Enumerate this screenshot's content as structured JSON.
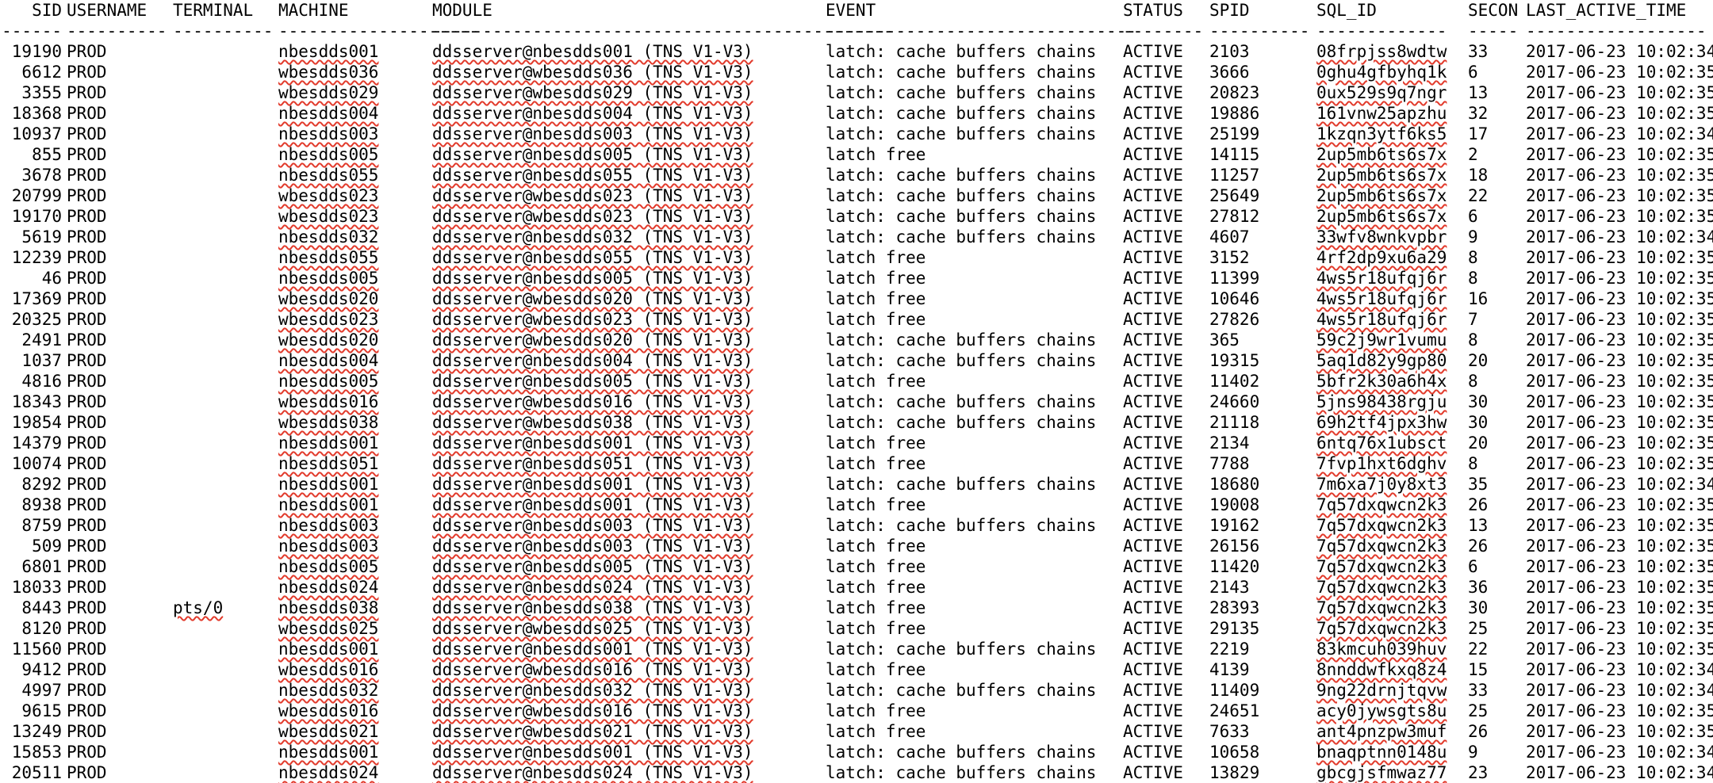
{
  "headers": {
    "sid": "SID",
    "username": "USERNAME",
    "terminal": "TERMINAL",
    "machine": "MACHINE",
    "module": "MODULE",
    "event": "EVENT",
    "status": "STATUS",
    "spid": "SPID",
    "sql_id": "SQL_ID",
    "secon": "SECON",
    "last_active_time": "LAST_ACTIVE_TIME"
  },
  "separators": {
    "sid": "------",
    "username": "----------",
    "terminal": "----------",
    "machine": "--------------------",
    "module": "----------------------------------------------",
    "event": "-------------------------------",
    "status": "--------",
    "spid": "----------",
    "sql_id": "-------------",
    "secon": "-----",
    "last_active_time": "------------------"
  },
  "rows": [
    {
      "sid": "19190",
      "username": "PROD",
      "terminal": "",
      "machine": "nbesdds001",
      "module": "ddsserver@nbesdds001 (TNS V1-V3)",
      "event": "latch: cache buffers chains",
      "status": "ACTIVE",
      "spid": "2103",
      "sql_id": "08frpjss8wdtw",
      "secon": "33",
      "last_active_time": "2017-06-23 10:02:34"
    },
    {
      "sid": "6612",
      "username": "PROD",
      "terminal": "",
      "machine": "wbesdds036",
      "module": "ddsserver@wbesdds036 (TNS V1-V3)",
      "event": "latch: cache buffers chains",
      "status": "ACTIVE",
      "spid": "3666",
      "sql_id": "0ghu4gfbyhq1k",
      "secon": "6",
      "last_active_time": "2017-06-23 10:02:35"
    },
    {
      "sid": "3355",
      "username": "PROD",
      "terminal": "",
      "machine": "wbesdds029",
      "module": "ddsserver@wbesdds029 (TNS V1-V3)",
      "event": "latch: cache buffers chains",
      "status": "ACTIVE",
      "spid": "20823",
      "sql_id": "0ux529s9q7ngr",
      "secon": "13",
      "last_active_time": "2017-06-23 10:02:35"
    },
    {
      "sid": "18368",
      "username": "PROD",
      "terminal": "",
      "machine": "nbesdds004",
      "module": "ddsserver@nbesdds004 (TNS V1-V3)",
      "event": "latch: cache buffers chains",
      "status": "ACTIVE",
      "spid": "19886",
      "sql_id": "161vnw25apzhu",
      "secon": "32",
      "last_active_time": "2017-06-23 10:02:35"
    },
    {
      "sid": "10937",
      "username": "PROD",
      "terminal": "",
      "machine": "nbesdds003",
      "module": "ddsserver@nbesdds003 (TNS V1-V3)",
      "event": "latch: cache buffers chains",
      "status": "ACTIVE",
      "spid": "25199",
      "sql_id": "1kzqn3ytf6ks5",
      "secon": "17",
      "last_active_time": "2017-06-23 10:02:34"
    },
    {
      "sid": "855",
      "username": "PROD",
      "terminal": "",
      "machine": "nbesdds005",
      "module": "ddsserver@nbesdds005 (TNS V1-V3)",
      "event": "latch free",
      "status": "ACTIVE",
      "spid": "14115",
      "sql_id": "2up5mb6ts6s7x",
      "secon": "2",
      "last_active_time": "2017-06-23 10:02:35"
    },
    {
      "sid": "3678",
      "username": "PROD",
      "terminal": "",
      "machine": "nbesdds055",
      "module": "ddsserver@nbesdds055 (TNS V1-V3)",
      "event": "latch: cache buffers chains",
      "status": "ACTIVE",
      "spid": "11257",
      "sql_id": "2up5mb6ts6s7x",
      "secon": "18",
      "last_active_time": "2017-06-23 10:02:35"
    },
    {
      "sid": "20799",
      "username": "PROD",
      "terminal": "",
      "machine": "wbesdds023",
      "module": "ddsserver@wbesdds023 (TNS V1-V3)",
      "event": "latch: cache buffers chains",
      "status": "ACTIVE",
      "spid": "25649",
      "sql_id": "2up5mb6ts6s7x",
      "secon": "22",
      "last_active_time": "2017-06-23 10:02:35"
    },
    {
      "sid": "19170",
      "username": "PROD",
      "terminal": "",
      "machine": "wbesdds023",
      "module": "ddsserver@wbesdds023 (TNS V1-V3)",
      "event": "latch: cache buffers chains",
      "status": "ACTIVE",
      "spid": "27812",
      "sql_id": "2up5mb6ts6s7x",
      "secon": "6",
      "last_active_time": "2017-06-23 10:02:35"
    },
    {
      "sid": "5619",
      "username": "PROD",
      "terminal": "",
      "machine": "nbesdds032",
      "module": "ddsserver@nbesdds032 (TNS V1-V3)",
      "event": "latch: cache buffers chains",
      "status": "ACTIVE",
      "spid": "4607",
      "sql_id": "33wfv8wnkvpbr",
      "secon": "9",
      "last_active_time": "2017-06-23 10:02:34"
    },
    {
      "sid": "12239",
      "username": "PROD",
      "terminal": "",
      "machine": "nbesdds055",
      "module": "ddsserver@nbesdds055 (TNS V1-V3)",
      "event": "latch free",
      "status": "ACTIVE",
      "spid": "3152",
      "sql_id": "4rf2dp9xu6a29",
      "secon": "8",
      "last_active_time": "2017-06-23 10:02:35"
    },
    {
      "sid": "46",
      "username": "PROD",
      "terminal": "",
      "machine": "nbesdds005",
      "module": "ddsserver@nbesdds005 (TNS V1-V3)",
      "event": "latch free",
      "status": "ACTIVE",
      "spid": "11399",
      "sql_id": "4ws5r18ufqj6r",
      "secon": "8",
      "last_active_time": "2017-06-23 10:02:35"
    },
    {
      "sid": "17369",
      "username": "PROD",
      "terminal": "",
      "machine": "wbesdds020",
      "module": "ddsserver@wbesdds020 (TNS V1-V3)",
      "event": "latch free",
      "status": "ACTIVE",
      "spid": "10646",
      "sql_id": "4ws5r18ufqj6r",
      "secon": "16",
      "last_active_time": "2017-06-23 10:02:35"
    },
    {
      "sid": "20325",
      "username": "PROD",
      "terminal": "",
      "machine": "wbesdds023",
      "module": "ddsserver@wbesdds023 (TNS V1-V3)",
      "event": "latch free",
      "status": "ACTIVE",
      "spid": "27826",
      "sql_id": "4ws5r18ufqj6r",
      "secon": "7",
      "last_active_time": "2017-06-23 10:02:35"
    },
    {
      "sid": "2491",
      "username": "PROD",
      "terminal": "",
      "machine": "wbesdds020",
      "module": "ddsserver@wbesdds020 (TNS V1-V3)",
      "event": "latch: cache buffers chains",
      "status": "ACTIVE",
      "spid": "365",
      "sql_id": "59c2j9wr1vumu",
      "secon": "8",
      "last_active_time": "2017-06-23 10:02:35"
    },
    {
      "sid": "1037",
      "username": "PROD",
      "terminal": "",
      "machine": "nbesdds004",
      "module": "ddsserver@nbesdds004 (TNS V1-V3)",
      "event": "latch: cache buffers chains",
      "status": "ACTIVE",
      "spid": "19315",
      "sql_id": "5aq1d82y9gp80",
      "secon": "20",
      "last_active_time": "2017-06-23 10:02:35"
    },
    {
      "sid": "4816",
      "username": "PROD",
      "terminal": "",
      "machine": "nbesdds005",
      "module": "ddsserver@nbesdds005 (TNS V1-V3)",
      "event": "latch free",
      "status": "ACTIVE",
      "spid": "11402",
      "sql_id": "5bfr2k30a6h4x",
      "secon": "8",
      "last_active_time": "2017-06-23 10:02:35"
    },
    {
      "sid": "18343",
      "username": "PROD",
      "terminal": "",
      "machine": "wbesdds016",
      "module": "ddsserver@wbesdds016 (TNS V1-V3)",
      "event": "latch: cache buffers chains",
      "status": "ACTIVE",
      "spid": "24660",
      "sql_id": "5jns98438rgju",
      "secon": "30",
      "last_active_time": "2017-06-23 10:02:35"
    },
    {
      "sid": "19854",
      "username": "PROD",
      "terminal": "",
      "machine": "wbesdds038",
      "module": "ddsserver@wbesdds038 (TNS V1-V3)",
      "event": "latch: cache buffers chains",
      "status": "ACTIVE",
      "spid": "21118",
      "sql_id": "69h2tf4jpx3hw",
      "secon": "30",
      "last_active_time": "2017-06-23 10:02:35"
    },
    {
      "sid": "14379",
      "username": "PROD",
      "terminal": "",
      "machine": "nbesdds001",
      "module": "ddsserver@nbesdds001 (TNS V1-V3)",
      "event": "latch free",
      "status": "ACTIVE",
      "spid": "2134",
      "sql_id": "6ntq76x1ubsct",
      "secon": "20",
      "last_active_time": "2017-06-23 10:02:35"
    },
    {
      "sid": "10074",
      "username": "PROD",
      "terminal": "",
      "machine": "nbesdds051",
      "module": "ddsserver@nbesdds051 (TNS V1-V3)",
      "event": "latch free",
      "status": "ACTIVE",
      "spid": "7788",
      "sql_id": "7fvp1hxt6dghv",
      "secon": "8",
      "last_active_time": "2017-06-23 10:02:35"
    },
    {
      "sid": "8292",
      "username": "PROD",
      "terminal": "",
      "machine": "nbesdds001",
      "module": "ddsserver@nbesdds001 (TNS V1-V3)",
      "event": "latch: cache buffers chains",
      "status": "ACTIVE",
      "spid": "18680",
      "sql_id": "7m6xa7j0y8xt3",
      "secon": "35",
      "last_active_time": "2017-06-23 10:02:34"
    },
    {
      "sid": "8938",
      "username": "PROD",
      "terminal": "",
      "machine": "nbesdds001",
      "module": "ddsserver@nbesdds001 (TNS V1-V3)",
      "event": "latch free",
      "status": "ACTIVE",
      "spid": "19008",
      "sql_id": "7q57dxqwcn2k3",
      "secon": "26",
      "last_active_time": "2017-06-23 10:02:35"
    },
    {
      "sid": "8759",
      "username": "PROD",
      "terminal": "",
      "machine": "nbesdds003",
      "module": "ddsserver@nbesdds003 (TNS V1-V3)",
      "event": "latch: cache buffers chains",
      "status": "ACTIVE",
      "spid": "19162",
      "sql_id": "7q57dxqwcn2k3",
      "secon": "13",
      "last_active_time": "2017-06-23 10:02:35"
    },
    {
      "sid": "509",
      "username": "PROD",
      "terminal": "",
      "machine": "nbesdds003",
      "module": "ddsserver@nbesdds003 (TNS V1-V3)",
      "event": "latch free",
      "status": "ACTIVE",
      "spid": "26156",
      "sql_id": "7q57dxqwcn2k3",
      "secon": "26",
      "last_active_time": "2017-06-23 10:02:35"
    },
    {
      "sid": "6801",
      "username": "PROD",
      "terminal": "",
      "machine": "nbesdds005",
      "module": "ddsserver@nbesdds005 (TNS V1-V3)",
      "event": "latch free",
      "status": "ACTIVE",
      "spid": "11420",
      "sql_id": "7q57dxqwcn2k3",
      "secon": "6",
      "last_active_time": "2017-06-23 10:02:35"
    },
    {
      "sid": "18033",
      "username": "PROD",
      "terminal": "",
      "machine": "nbesdds024",
      "module": "ddsserver@nbesdds024 (TNS V1-V3)",
      "event": "latch free",
      "status": "ACTIVE",
      "spid": "2143",
      "sql_id": "7q57dxqwcn2k3",
      "secon": "36",
      "last_active_time": "2017-06-23 10:02:35"
    },
    {
      "sid": "8443",
      "username": "PROD",
      "terminal": "pts/0",
      "machine": "nbesdds038",
      "module": "ddsserver@nbesdds038 (TNS V1-V3)",
      "event": "latch free",
      "status": "ACTIVE",
      "spid": "28393",
      "sql_id": "7q57dxqwcn2k3",
      "secon": "30",
      "last_active_time": "2017-06-23 10:02:35"
    },
    {
      "sid": "8120",
      "username": "PROD",
      "terminal": "",
      "machine": "wbesdds025",
      "module": "ddsserver@wbesdds025 (TNS V1-V3)",
      "event": "latch free",
      "status": "ACTIVE",
      "spid": "29135",
      "sql_id": "7q57dxqwcn2k3",
      "secon": "25",
      "last_active_time": "2017-06-23 10:02:35"
    },
    {
      "sid": "11560",
      "username": "PROD",
      "terminal": "",
      "machine": "nbesdds001",
      "module": "ddsserver@nbesdds001 (TNS V1-V3)",
      "event": "latch: cache buffers chains",
      "status": "ACTIVE",
      "spid": "2219",
      "sql_id": "83kmcuh039huv",
      "secon": "22",
      "last_active_time": "2017-06-23 10:02:35"
    },
    {
      "sid": "9412",
      "username": "PROD",
      "terminal": "",
      "machine": "wbesdds016",
      "module": "ddsserver@wbesdds016 (TNS V1-V3)",
      "event": "latch free",
      "status": "ACTIVE",
      "spid": "4139",
      "sql_id": "8nnddwfkxq8z4",
      "secon": "15",
      "last_active_time": "2017-06-23 10:02:34"
    },
    {
      "sid": "4997",
      "username": "PROD",
      "terminal": "",
      "machine": "nbesdds032",
      "module": "ddsserver@nbesdds032 (TNS V1-V3)",
      "event": "latch: cache buffers chains",
      "status": "ACTIVE",
      "spid": "11409",
      "sql_id": "9ng22drnjtqvw",
      "secon": "33",
      "last_active_time": "2017-06-23 10:02:34"
    },
    {
      "sid": "9615",
      "username": "PROD",
      "terminal": "",
      "machine": "wbesdds016",
      "module": "ddsserver@wbesdds016 (TNS V1-V3)",
      "event": "latch free",
      "status": "ACTIVE",
      "spid": "24651",
      "sql_id": "acy0jywsgts8u",
      "secon": "25",
      "last_active_time": "2017-06-23 10:02:35"
    },
    {
      "sid": "13249",
      "username": "PROD",
      "terminal": "",
      "machine": "wbesdds021",
      "module": "ddsserver@wbesdds021 (TNS V1-V3)",
      "event": "latch free",
      "status": "ACTIVE",
      "spid": "7633",
      "sql_id": "ant4pnzpw3muf",
      "secon": "26",
      "last_active_time": "2017-06-23 10:02:35"
    },
    {
      "sid": "15853",
      "username": "PROD",
      "terminal": "",
      "machine": "nbesdds001",
      "module": "ddsserver@nbesdds001 (TNS V1-V3)",
      "event": "latch: cache buffers chains",
      "status": "ACTIVE",
      "spid": "10658",
      "sql_id": "bnaqptnn0148u",
      "secon": "9",
      "last_active_time": "2017-06-23 10:02:34"
    },
    {
      "sid": "20511",
      "username": "PROD",
      "terminal": "",
      "machine": "nbesdds024",
      "module": "ddsserver@nbesdds024 (TNS V1-V3)",
      "event": "latch: cache buffers chains",
      "status": "ACTIVE",
      "spid": "13829",
      "sql_id": "gbcgjsfmwaz77",
      "secon": "23",
      "last_active_time": "2017-06-23 10:02:34"
    }
  ]
}
